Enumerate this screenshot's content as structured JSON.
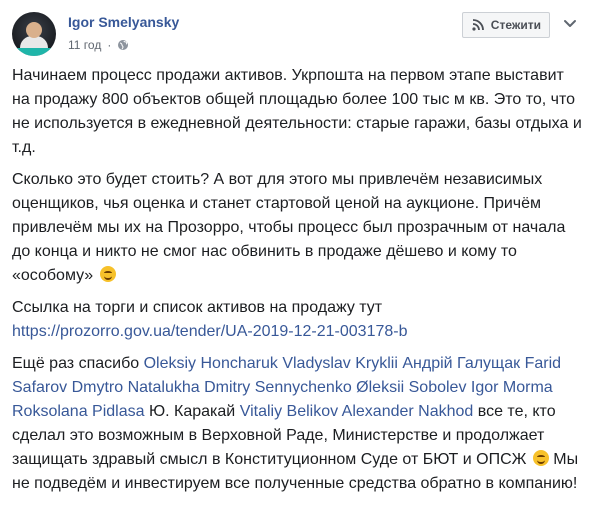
{
  "header": {
    "author": "Igor Smelyansky",
    "time": "11 год",
    "follow_label": "Стежити",
    "icons": [
      "avatar",
      "globe-icon",
      "rss-icon",
      "chevron-down-icon"
    ]
  },
  "post": {
    "p1": "Начинаем процесс продажи активов. Укрпошта на первом этапе выставит на продажу 800 объектов общей площадью более 100 тыс м кв. Это то, что не используется в ежедневной деятельности: старые гаражи, базы отдыха и т.д.",
    "p2": "Сколько это будет стоить? А вот для этого мы привлечём независимых оценщиков, чья оценка и станет стартовой ценой на аукционе. Причём привлечём мы их на Прозорро, чтобы процесс был прозрачным от начала до конца и никто не смог нас обвинить в продаже дёшево и кому то «особому»",
    "p3_text": "Ссылка на торги и список активов на продажу тут ",
    "p3_link": "https://prozorro.gov.ua/tender/UA-2019-12-21-003178-b",
    "p4_intro": "Ещё раз спасибо ",
    "mentions_1": [
      "Oleksiy Honcharuk",
      "Vladyslav Kryklii",
      "Андрій Галущак",
      "Farid Safarov",
      "Dmytro Natalukha",
      "Dmitry Sennychenko",
      "Øleksii Sobolev",
      "Igor Morma",
      "Roksolana Pidlasa"
    ],
    "p4_mid": " Ю. Каракай ",
    "mentions_2": [
      "Vitaliy Belikov",
      "Alexander Nakhod"
    ],
    "p4_end_a": " все те, кто сделал это возможным в Верховной Раде, Министерстве и продолжает защищать здравый смысл в Конституционном Суде от БЮТ и ОПСЖ",
    "p4_end_b": " Мы не подведём и инвестируем все полученные средства обратно в компанию!"
  }
}
